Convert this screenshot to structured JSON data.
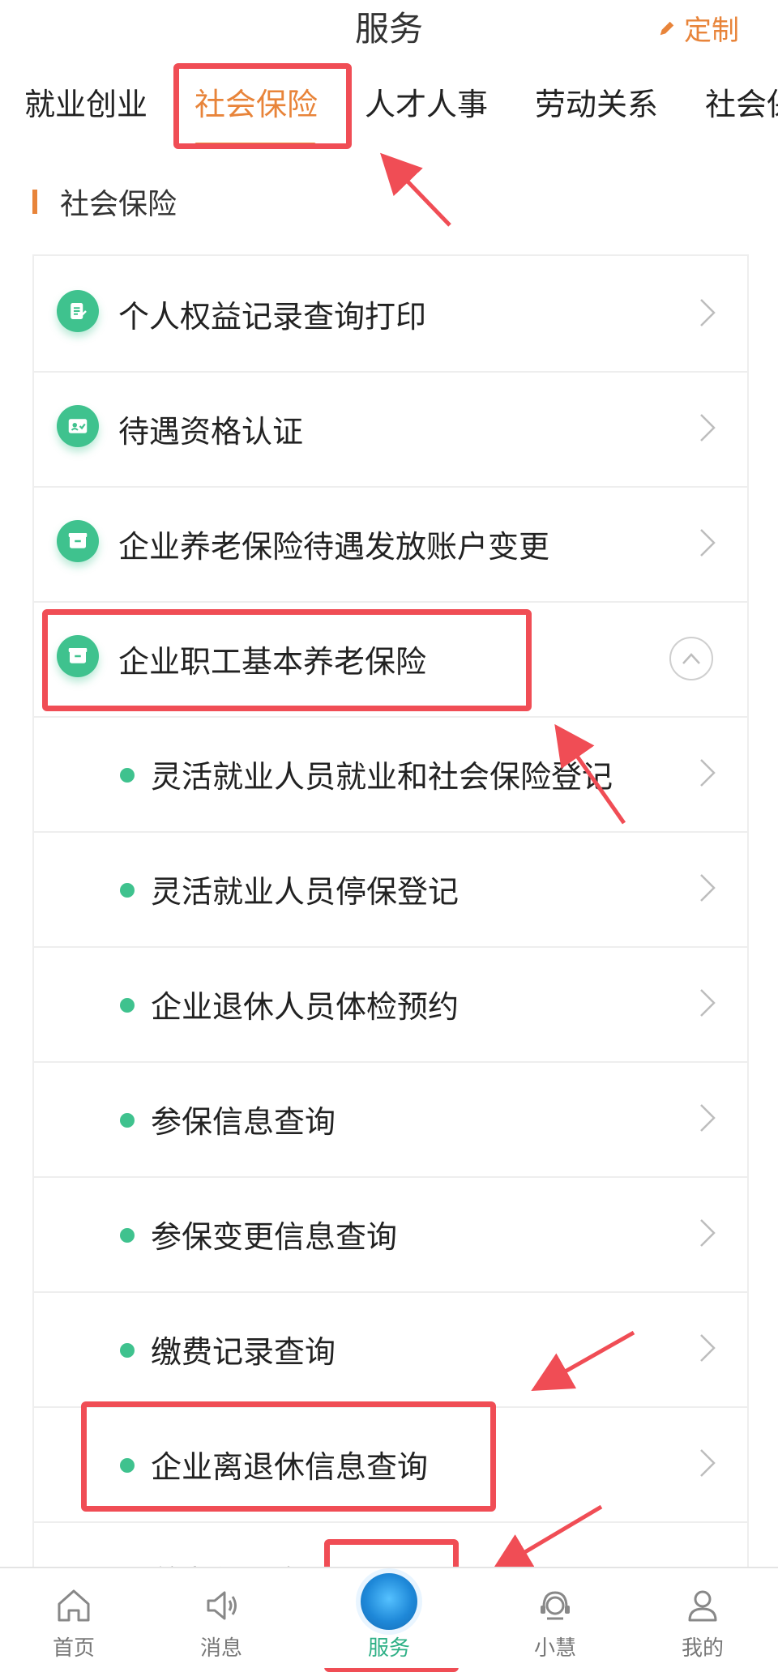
{
  "header": {
    "title": "服务",
    "customize_label": "定制"
  },
  "tabs": [
    {
      "label": "就业创业"
    },
    {
      "label": "社会保险"
    },
    {
      "label": "人才人事"
    },
    {
      "label": "劳动关系"
    },
    {
      "label": "社会保"
    }
  ],
  "section": {
    "title": "社会保险"
  },
  "list": {
    "items": [
      {
        "label": "个人权益记录查询打印",
        "icon": "document-edit-icon"
      },
      {
        "label": "待遇资格认证",
        "icon": "id-card-check-icon"
      },
      {
        "label": "企业养老保险待遇发放账户变更",
        "icon": "box-icon"
      },
      {
        "label": "企业职工基本养老保险",
        "icon": "box-icon",
        "expanded": true
      }
    ],
    "sub_items": [
      {
        "label": "灵活就业人员就业和社会保险登记"
      },
      {
        "label": "灵活就业人员停保登记"
      },
      {
        "label": "企业退休人员体检预约"
      },
      {
        "label": "参保信息查询"
      },
      {
        "label": "参保变更信息查询"
      },
      {
        "label": "缴费记录查询"
      },
      {
        "label": "企业离退休信息查询"
      },
      {
        "label": "养老待遇发..."
      }
    ]
  },
  "bottom_nav": [
    {
      "label": "首页",
      "icon": "home-icon"
    },
    {
      "label": "消息",
      "icon": "speaker-icon"
    },
    {
      "label": "服务",
      "icon": "service-logo-icon",
      "active": true
    },
    {
      "label": "小慧",
      "icon": "headset-icon"
    },
    {
      "label": "我的",
      "icon": "user-icon"
    }
  ],
  "colors": {
    "accent": "#e8843a",
    "green": "#3fc28e",
    "annotation_red": "#f04d55"
  }
}
